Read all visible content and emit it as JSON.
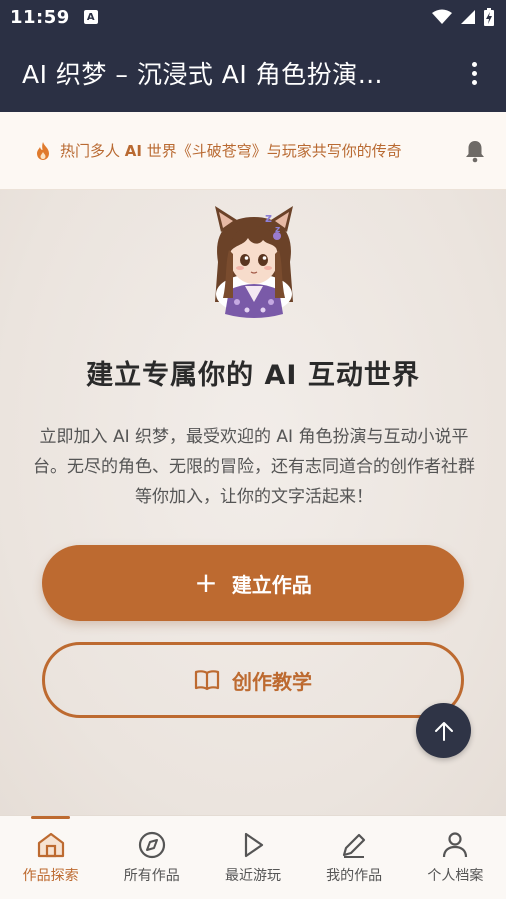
{
  "status_bar": {
    "time": "11:59",
    "a_badge": "A"
  },
  "app_bar": {
    "title": "AI 织梦 – 沉浸式 AI 角色扮演…",
    "more_icon": "more-vert-icon"
  },
  "announcement": {
    "prefix": "热门多人 ",
    "highlight": "AI",
    "suffix": " 世界《斗破苍穹》与玩家共写你的传奇",
    "fire_icon": "fire-icon",
    "bell_icon": "bell-icon"
  },
  "hero": {
    "headline": "建立专属你的 AI 互动世界",
    "intro": "立即加入 AI 织梦，最受欢迎的 AI 角色扮演与互动小说平台。无尽的角色、无限的冒险，还有志同道合的创作者社群等你加入，让你的文字活起来！",
    "create_button": "建立作品",
    "tutorial_button": "创作教学"
  },
  "bottom_nav": {
    "items": [
      {
        "label": "作品探索",
        "icon": "home-icon",
        "active": true
      },
      {
        "label": "所有作品",
        "icon": "compass-icon",
        "active": false
      },
      {
        "label": "最近游玩",
        "icon": "play-icon",
        "active": false
      },
      {
        "label": "我的作品",
        "icon": "pencil-icon",
        "active": false
      },
      {
        "label": "个人档案",
        "icon": "person-icon",
        "active": false
      }
    ]
  },
  "colors": {
    "accent": "#bd6a30",
    "header": "#2b3044",
    "announce_bg": "#fdf8f3"
  }
}
